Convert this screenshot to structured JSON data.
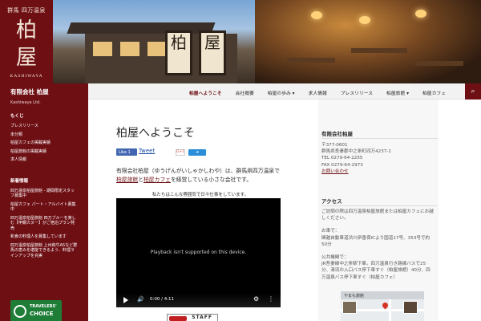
{
  "logo": {
    "top_text": "群馬 四万温泉",
    "big_text_1": "柏",
    "big_text_2": "屋",
    "bottom_text": "KASHIWAYA"
  },
  "lanterns": [
    "柏",
    "屋"
  ],
  "site": {
    "title": "有限会社 柏屋",
    "subtitle": "Kashiwaya Ltd."
  },
  "nav": {
    "items": [
      {
        "label": "柏屋へようこそ",
        "active": true
      },
      {
        "label": "会社概要",
        "active": false
      },
      {
        "label": "柏屋の歩み ▾",
        "active": false
      },
      {
        "label": "求人情報",
        "active": false
      },
      {
        "label": "プレスリリース",
        "active": false
      },
      {
        "label": "柏屋旅館 ▾",
        "active": false
      },
      {
        "label": "柏屋カフェ",
        "active": false
      }
    ]
  },
  "sidebar": {
    "toc_heading": "もくじ",
    "toc": [
      "プレスリリース",
      "未分類",
      "柏屋カフェの掲載実績",
      "柏屋旅館の掲載実績",
      "求人情報"
    ],
    "news_heading": "新着情報",
    "news": [
      "四万温泉柏屋旅館 - 期間限定スタッフ募集中",
      "柏屋カフェ パート・アルバイト募集中",
      "四万温泉柏屋旅館 四万ブルーを楽しむ【甲鋼カヌー】がご宿泊プラン発売",
      "和食の料理人を募集しています",
      "四万温泉柏屋旅館 上州和牛A5など群馬の恵みを堪能できるよう、料理ラインアップを充実"
    ],
    "badge": {
      "line1": "TRAVELERS'",
      "line2": "CHOICE"
    }
  },
  "main": {
    "title": "柏屋へようこそ",
    "fb_like": "Like 1",
    "tweet": "Tweet",
    "gplus": "G+1",
    "intro_1": "有限会社柏屋（ゆうげんがいしゃかしわや）は、群馬県四万温泉で",
    "intro_link_1": "柏屋旅館",
    "intro_2": "と",
    "intro_link_2": "柏屋カフェ",
    "intro_3": "を経営している小さな会社です。",
    "caption": "私たちはこんな雰囲気で日々仕事をしています。",
    "video": {
      "message": "Playback isn't supported on this device.",
      "time": "0:00 / 4:11"
    },
    "staff_banner": "STAFF"
  },
  "right": {
    "company_heading": "有限会社柏屋",
    "postal": "〒377-0601",
    "address": "群馬県吾妻郡中之条町四万4237-1",
    "tel": "TEL 0279-64-2255",
    "fax": "FAX 0279-64-2973",
    "contact": "お問い合わせ",
    "access_heading": "アクセス",
    "access_intro": "ご訪問の際は四万温泉柏屋旅館または柏屋カフェにお越しください。",
    "car_heading": "お車で：",
    "car_text": "関越自動車道渋川伊香保ICより国道17号、353号で約50分",
    "transit_heading": "公共機関で：",
    "transit_text": "JR吾妻線中之条駅下車。四万温泉行き路線バスで25分、清流の入口バス停下車すぐ（柏屋旅館）40分、四万温泉バス停下車すぐ（柏屋カフェ）",
    "map_label": "やまも旅館"
  }
}
